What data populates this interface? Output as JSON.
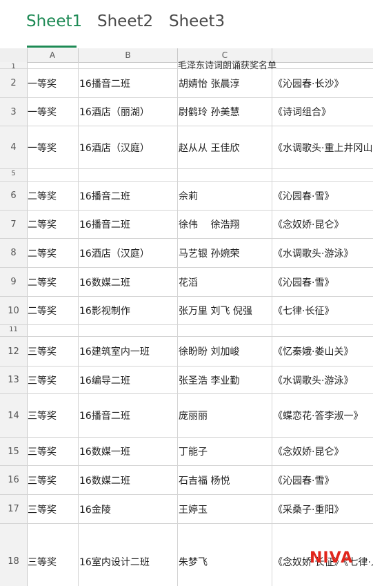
{
  "tabs": [
    {
      "label": "Sheet1",
      "active": true
    },
    {
      "label": "Sheet2",
      "active": false
    },
    {
      "label": "Sheet3",
      "active": false
    }
  ],
  "columns": [
    "A",
    "B",
    "C"
  ],
  "title": "毛泽东诗词朗诵获奖名单",
  "rows": [
    {
      "num": "1",
      "a": "",
      "b": "",
      "c": "",
      "d": ""
    },
    {
      "num": "2",
      "a": "一等奖",
      "b": "16播音二班",
      "c": "胡婧怡 张晨淳",
      "d": "《沁园春·长沙》"
    },
    {
      "num": "3",
      "a": "一等奖",
      "b": "16酒店（丽湖）",
      "c": "尉鹤玲 孙美慧",
      "d": "《诗词组合》"
    },
    {
      "num": "4",
      "a": "一等奖",
      "b": "16酒店（汉庭）",
      "c": "赵从从 王佳欣",
      "d": "《水调歌头·重上井冈山"
    },
    {
      "num": "5",
      "a": "",
      "b": "",
      "c": "",
      "d": ""
    },
    {
      "num": "6",
      "a": "二等奖",
      "b": "16播音二班",
      "c": "佘莉",
      "d": "《沁园春·雪》"
    },
    {
      "num": "7",
      "a": "二等奖",
      "b": "16播音二班",
      "c": "徐伟　 徐浩翔",
      "d": "《念奴娇·昆仑》"
    },
    {
      "num": "8",
      "a": "二等奖",
      "b": "16酒店（汉庭）",
      "c": "马艺银 孙婉荣",
      "d": "《水调歌头·游泳》"
    },
    {
      "num": "9",
      "a": "二等奖",
      "b": "16数媒二班",
      "c": "花滔",
      "d": "《沁园春·雪》"
    },
    {
      "num": "10",
      "a": "二等奖",
      "b": "16影视制作",
      "c": "张万里 刘飞 倪强",
      "d": "《七律·长征》"
    },
    {
      "num": "11",
      "a": "",
      "b": "",
      "c": "",
      "d": ""
    },
    {
      "num": "12",
      "a": "三等奖",
      "b": "16建筑室内一班",
      "c": "徐盼盼 刘加峻",
      "d": "《忆秦娥·娄山关》"
    },
    {
      "num": "13",
      "a": "三等奖",
      "b": "16编导二班",
      "c": "张圣浩 李业勤",
      "d": "《水调歌头·游泳》"
    },
    {
      "num": "14",
      "a": "三等奖",
      "b": "16播音二班",
      "c": "庞丽丽",
      "d": "《蝶恋花·答李淑一》"
    },
    {
      "num": "15",
      "a": "三等奖",
      "b": "16数媒一班",
      "c": "丁能子",
      "d": "《念奴娇·昆仑》"
    },
    {
      "num": "16",
      "a": "三等奖",
      "b": "16数媒二班",
      "c": "石吉福 杨悦",
      "d": "《沁园春·雪》"
    },
    {
      "num": "17",
      "a": "三等奖",
      "b": "16金陵",
      "c": "王婷玉",
      "d": "《采桑子·重阳》"
    },
    {
      "num": "18",
      "a": "三等奖",
      "b": "16室内设计二班",
      "c": "朱梦飞",
      "d": "《念奴娇·长征》《七律·人"
    }
  ],
  "watermark": "NIVA"
}
